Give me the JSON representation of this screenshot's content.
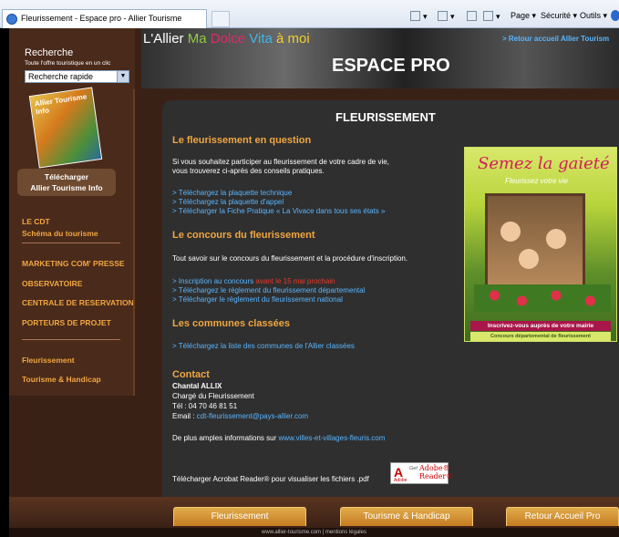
{
  "browser": {
    "tab_title": "Fleurissement - Espace pro - Allier Tourisme",
    "page_menu": "Page ▾",
    "securite_menu": "Sécurité ▾",
    "outils_menu": "Outils ▾"
  },
  "header": {
    "title_lallier": "L'Allier ",
    "title_ma": "Ma ",
    "title_dolce": "Dolce ",
    "title_vita": "Vita ",
    "title_amoi": "à moi",
    "retour_link": "> Retour accueil Allier Tourism",
    "banner": "ESPACE PRO"
  },
  "sidebar": {
    "search_title": "Recherche",
    "search_subtitle": "Toute l'offre touristique en un clic",
    "search_select": "Recherche rapide",
    "download_label": "Télécharger",
    "download_title": "Allier Tourisme Info",
    "items": [
      {
        "label": "LE CDT"
      },
      {
        "label": "Schéma du tourisme"
      },
      {
        "label": "MARKETING COM' PRESSE"
      },
      {
        "label": "OBSERVATOIRE"
      },
      {
        "label": "CENTRALE DE RESERVATION"
      },
      {
        "label": "PORTEURS DE PROJET"
      },
      {
        "label": "Fleurissement"
      },
      {
        "label": "Tourisme & Handicap"
      }
    ]
  },
  "main": {
    "title": "FLEURISSEMENT",
    "s1_heading": "Le fleurissement en question",
    "s1_text1": "Si vous souhaitez participer au fleurissement de votre cadre de vie,",
    "s1_text2": "vous trouverez ci-après des conseils pratiques.",
    "s1_link1": "> Téléchargez la plaquette technique",
    "s1_link2": "> Téléchargez la plaquette d'appel",
    "s1_link3": "> Télécharger la Fiche Pratique « La Vivace dans tous ses états »",
    "s2_heading": "Le concours du fleurissement",
    "s2_text": "Tout savoir sur le concours du fleurissement et la procédure d'inscription.",
    "s2_link1": "> Inscription au concours ",
    "s2_link1_red": "avant le 15 mai prochain",
    "s2_link2": "> Téléchargez le règlement du fleurissement départemental",
    "s2_link3": "> Télécharger le règlement du fleurissement national",
    "s3_heading": "Les communes classées",
    "s3_link": "> Téléchargez la liste des communes de l'Allier classées",
    "contact_heading": "Contact",
    "contact_name": "Chantal ALLIX",
    "contact_role": "Chargé du Fleurissement",
    "contact_tel": "Tél : 04 70 46 81 51",
    "contact_email_label": "Email : ",
    "contact_email": "cdt-fleurissement@pays-allier.com",
    "more_info_text": "De plus amples informations sur ",
    "more_info_link": "www.villes-et-villages-fleuris.com",
    "acrobat_text": "Télécharger Acrobat Reader® pour visualiser les fichiers .pdf"
  },
  "poster": {
    "title": "Semez la gaieté",
    "subtitle": "Fleurissez votre vie",
    "band1": "Inscrivez-vous auprès de votre mairie",
    "band2": "Concours départemental de fleurissement"
  },
  "acrobat_badge": {
    "get": "Get",
    "adobe": "Adobe®",
    "reader": "Reader®",
    "small": "Adobe"
  },
  "bottom": {
    "btn1": "Fleurissement",
    "btn2": "Tourisme & Handicap",
    "btn3": "Retour Accueil Pro",
    "footer": "www.allier-tourisme.com | mentions légales"
  }
}
